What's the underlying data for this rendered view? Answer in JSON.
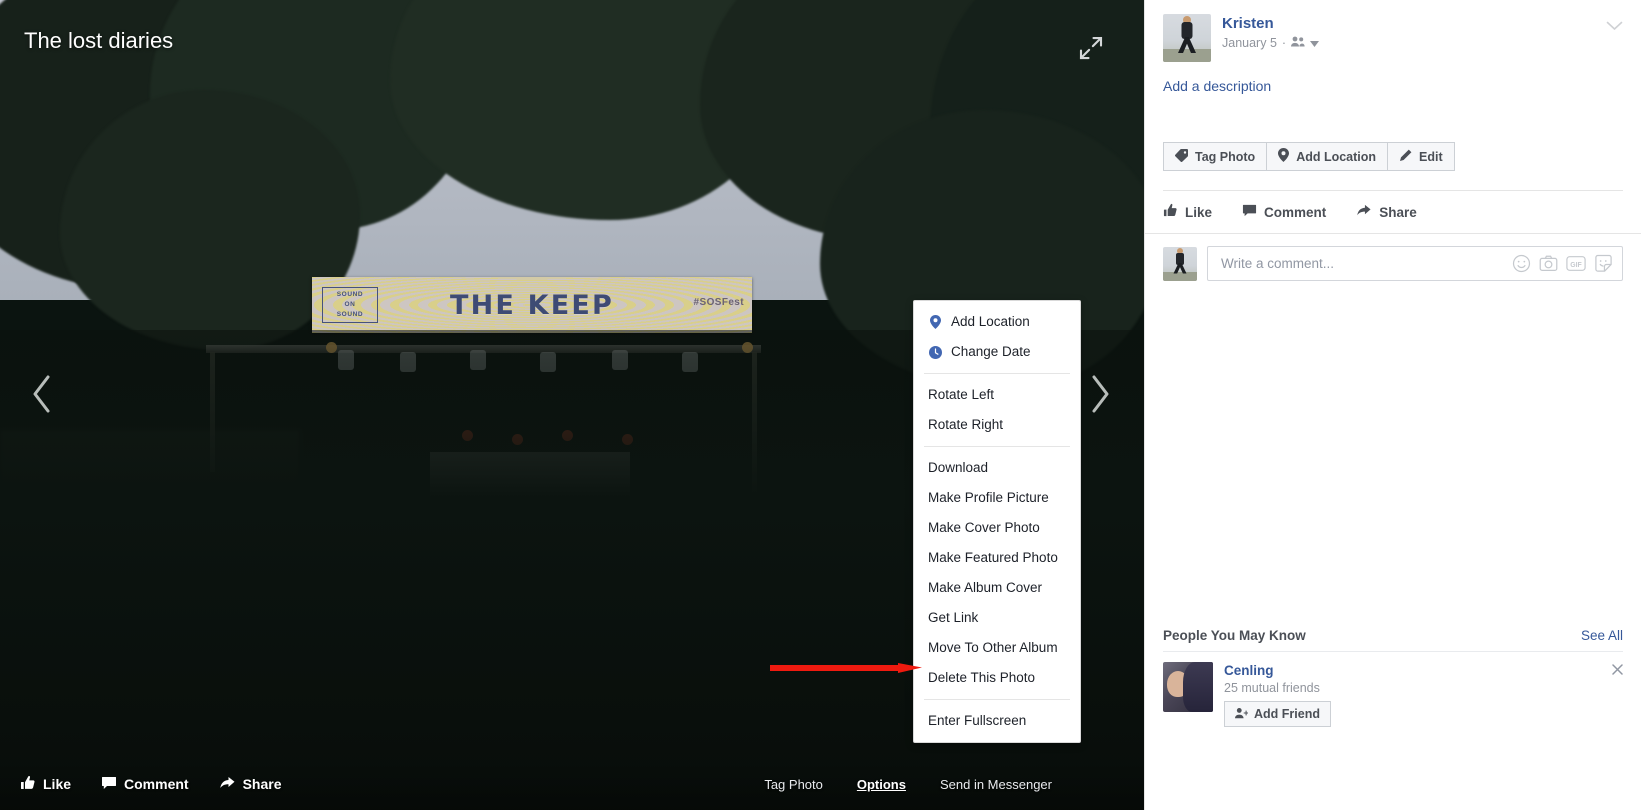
{
  "photo": {
    "album_title": "The lost diaries",
    "expand_icon": "expand-diagonal-icon",
    "prev_icon": "chevron-left-icon",
    "next_icon": "chevron-right-icon",
    "banner": {
      "main_text": "THE KEEP",
      "logo_line1": "SOUND",
      "logo_line2": "ON",
      "logo_line3": "SOUND",
      "hashtag": "#SOSFest"
    },
    "bottom_bar": {
      "like": "Like",
      "comment": "Comment",
      "share": "Share",
      "tag_photo": "Tag Photo",
      "options": "Options",
      "send_in_messenger": "Send in Messenger"
    }
  },
  "context_menu": {
    "groups": [
      {
        "items": [
          {
            "label": "Add Location",
            "icon": "location-pin-icon"
          },
          {
            "label": "Change Date",
            "icon": "clock-icon"
          }
        ]
      },
      {
        "items": [
          {
            "label": "Rotate Left",
            "icon": ""
          },
          {
            "label": "Rotate Right",
            "icon": ""
          }
        ]
      },
      {
        "items": [
          {
            "label": "Download",
            "icon": ""
          },
          {
            "label": "Make Profile Picture",
            "icon": ""
          },
          {
            "label": "Make Cover Photo",
            "icon": ""
          },
          {
            "label": "Make Featured Photo",
            "icon": ""
          },
          {
            "label": "Make Album Cover",
            "icon": ""
          },
          {
            "label": "Get Link",
            "icon": ""
          },
          {
            "label": "Move To Other Album",
            "icon": ""
          },
          {
            "label": "Delete This Photo",
            "icon": ""
          }
        ]
      },
      {
        "items": [
          {
            "label": "Enter Fullscreen",
            "icon": ""
          }
        ]
      }
    ]
  },
  "sidebar": {
    "post": {
      "author": "Kristen",
      "date": "January 5",
      "separator": "·",
      "privacy_icon": "friends-icon",
      "privacy_caret": "caret-down-icon",
      "menu_caret": "chevron-down-icon",
      "description_placeholder": "Add a description"
    },
    "actions": [
      {
        "label": "Tag Photo",
        "icon": "tag-icon"
      },
      {
        "label": "Add Location",
        "icon": "location-pin-icon"
      },
      {
        "label": "Edit",
        "icon": "pencil-icon"
      }
    ],
    "social": [
      {
        "label": "Like",
        "icon": "thumbs-up-icon"
      },
      {
        "label": "Comment",
        "icon": "speech-bubble-icon"
      },
      {
        "label": "Share",
        "icon": "share-arrow-icon"
      }
    ],
    "comment_box": {
      "placeholder": "Write a comment...",
      "value": "",
      "icons": [
        "emoji-icon",
        "camera-icon",
        "gif-icon",
        "sticker-icon"
      ]
    },
    "pymk": {
      "title": "People You May Know",
      "see_all": "See All",
      "people": [
        {
          "name": "Cenling",
          "mutual": "25 mutual friends",
          "add_label": "Add Friend",
          "add_icon": "add-friend-icon",
          "close_icon": "close-icon"
        }
      ]
    }
  },
  "annotation": {
    "arrow_color": "#ef1a0f",
    "points_to": "Delete This Photo"
  },
  "colors": {
    "fb_blue": "#365899",
    "text_dark": "#1d2129",
    "text_muted": "#90949c",
    "border": "#ccd0d5"
  }
}
